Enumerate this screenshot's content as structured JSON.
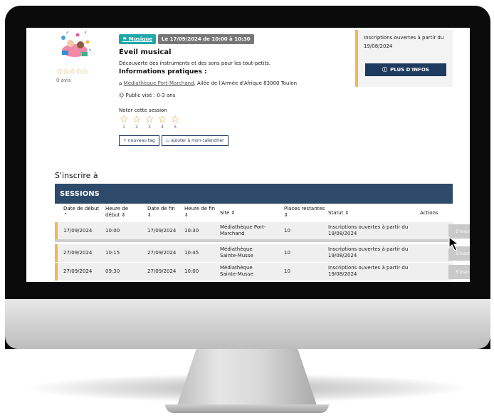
{
  "event": {
    "category": "Musique",
    "date_badge": "Le 17/09/2024 de 10:00 à 10:30",
    "title": "Éveil musical",
    "description": "Découverte des instruments et des sons pour les tout-petits.",
    "info_title": "Informations pratiques :",
    "location_link": "Médiathèque Port-Marchand",
    "location_rest": ", Allée de l'Armée d'Afrique 83000 Toulon",
    "public": "Public visé : 0-3 ans",
    "rating_label": "Noter cette session",
    "avis": "0 avis",
    "star_numbers": [
      "1",
      "2",
      "3",
      "4",
      "5"
    ],
    "btn_tag": "+ nouveau tag",
    "btn_calendar": "ajouter à mon calendrier"
  },
  "side": {
    "text": "Inscriptions ouvertes à partir du 19/08/2024",
    "button": "PLUS D'INFOS",
    "accent": "#f1b84d"
  },
  "sessions": {
    "heading": "S'inscrire à",
    "title": "SESSIONS",
    "header_color": "#2d4a6b",
    "columns": [
      "Date de début ⌃",
      "Heure de début ⇕",
      "Date de fin ⇕",
      "Heure de fin ⇕",
      "Site ⇕",
      "Places restantes ⇕",
      "Statut ⇕",
      "Actions"
    ],
    "rows": [
      {
        "start": "17/09/2024",
        "hstart": "10:00",
        "end": "17/09/2024",
        "hend": "10:30",
        "site": "Médiathèque Port-Marchand",
        "places": "10",
        "status": "Inscriptions ouvertes à partir du 19/08/2024",
        "action": "S'inscrire"
      },
      {
        "start": "27/09/2024",
        "hstart": "10:15",
        "end": "27/09/2024",
        "hend": "10:45",
        "site": "Médiathèque Sainte-Musse",
        "places": "10",
        "status": "Inscriptions ouvertes à partir du 19/08/2024",
        "action": "S'inscrire"
      },
      {
        "start": "27/09/2024",
        "hstart": "09:30",
        "end": "27/09/2024",
        "hend": "10:00",
        "site": "Médiathèque Sainte-Musse",
        "places": "10",
        "status": "Inscriptions ouvertes à partir du 19/08/2024",
        "action": "S'inscrire"
      }
    ]
  },
  "icons": {
    "category": "tag-icon",
    "location": "home-icon",
    "public": "person-icon",
    "info": "info-icon",
    "calendar": "calendar-icon",
    "cursor": "mouse-pointer-icon"
  }
}
